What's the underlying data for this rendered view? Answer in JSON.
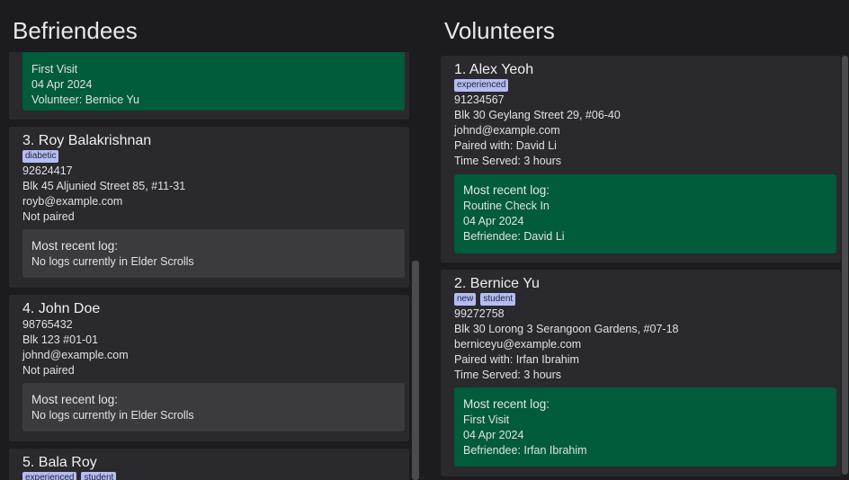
{
  "befriendees": {
    "title": "Befriendees",
    "partial_card": {
      "log_type": "First Visit",
      "log_date": "04 Apr 2024",
      "log_partner": "Volunteer: Bernice Yu"
    },
    "cards": [
      {
        "name": "3.  Roy Balakrishnan",
        "tags": [
          "diabetic"
        ],
        "phone": "92624417",
        "address": "Blk 45 Aljunied Street 85, #11-31",
        "email": "royb@example.com",
        "pairing": "Not paired",
        "log_heading": "Most recent log:",
        "log_text": "No logs currently in Elder Scrolls"
      },
      {
        "name": "4.  John Doe",
        "phone": "98765432",
        "address": "Blk 123 #01-01",
        "email": "johnd@example.com",
        "pairing": "Not paired",
        "log_heading": "Most recent log:",
        "log_text": "No logs currently in Elder Scrolls"
      },
      {
        "name": "5.  Bala Roy",
        "tags": [
          "experienced",
          "student"
        ]
      }
    ]
  },
  "volunteers": {
    "title": "Volunteers",
    "cards": [
      {
        "name": "1.  Alex Yeoh",
        "tags": [
          "experienced"
        ],
        "phone": "91234567",
        "address": "Blk 30 Geylang Street 29, #06-40",
        "email": "johnd@example.com",
        "pairing": "Paired with: David Li",
        "time_served": "Time Served: 3 hours",
        "log_heading": "Most recent log:",
        "log_type": "Routine Check In",
        "log_date": "04 Apr 2024",
        "log_partner": "Befriendee: David Li"
      },
      {
        "name": "2.  Bernice Yu",
        "tags": [
          "new",
          "student"
        ],
        "phone": "99272758",
        "address": "Blk 30 Lorong 3 Serangoon Gardens, #07-18",
        "email": "berniceyu@example.com",
        "pairing": "Paired with: Irfan Ibrahim",
        "time_served": "Time Served: 3 hours",
        "log_heading": "Most recent log:",
        "log_type": "First Visit",
        "log_date": "04 Apr 2024",
        "log_partner": "Befriendee: Irfan Ibrahim"
      }
    ]
  },
  "colors": {
    "background": "#1c1c20",
    "card": "#29292e",
    "log_present": "#005c3a",
    "log_empty": "#3a3a3f",
    "tag": "#b5bdf0"
  }
}
